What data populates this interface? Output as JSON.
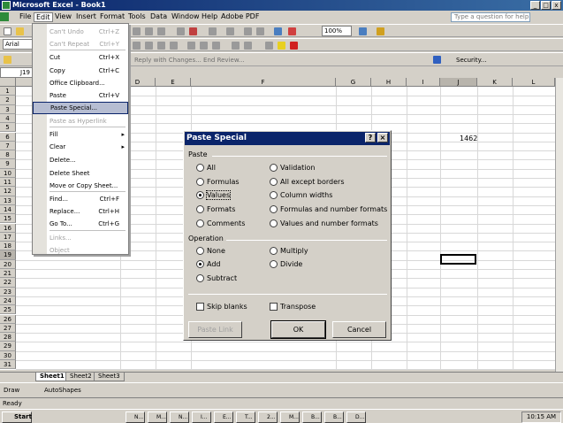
{
  "app": {
    "title": "Microsoft Excel - Book1"
  },
  "menubar": {
    "items": [
      "File",
      "Edit",
      "View",
      "Insert",
      "Format",
      "Tools",
      "Data",
      "Window",
      "Help",
      "Adobe PDF"
    ],
    "help_placeholder": "Type a question for help"
  },
  "toolbar": {
    "font": "Arial",
    "zoom": "100%",
    "review_text": "Reply with Changes...  End Review...",
    "security": "Security..."
  },
  "namebox": {
    "value": "J19"
  },
  "columns": [
    "D",
    "E",
    "F",
    "G",
    "H",
    "I",
    "J",
    "K",
    "L"
  ],
  "rows": [
    "1",
    "2",
    "3",
    "4",
    "5",
    "6",
    "7",
    "8",
    "9",
    "10",
    "11",
    "12",
    "13",
    "14",
    "15",
    "16",
    "17",
    "18",
    "19",
    "20",
    "21",
    "22",
    "23",
    "24",
    "25",
    "26",
    "27",
    "28",
    "29",
    "30",
    "31"
  ],
  "cells": {
    "J6": "1462"
  },
  "edit_menu": {
    "items": [
      {
        "label": "Can't Undo",
        "shortcut": "Ctrl+Z",
        "disabled": true
      },
      {
        "label": "Can't Repeat",
        "shortcut": "Ctrl+Y",
        "disabled": true
      },
      {
        "label": "Cut",
        "shortcut": "Ctrl+X"
      },
      {
        "label": "Copy",
        "shortcut": "Ctrl+C"
      },
      {
        "label": "Office Clipboard..."
      },
      {
        "label": "Paste",
        "shortcut": "Ctrl+V"
      },
      {
        "label": "Paste Special...",
        "highlight": true
      },
      {
        "label": "Paste as Hyperlink",
        "disabled": true
      },
      {
        "label": "Fill",
        "submenu": true
      },
      {
        "label": "Clear",
        "submenu": true
      },
      {
        "label": "Delete..."
      },
      {
        "label": "Delete Sheet"
      },
      {
        "label": "Move or Copy Sheet..."
      },
      {
        "label": "Find...",
        "shortcut": "Ctrl+F"
      },
      {
        "label": "Replace...",
        "shortcut": "Ctrl+H"
      },
      {
        "label": "Go To...",
        "shortcut": "Ctrl+G"
      },
      {
        "label": "Links...",
        "disabled": true
      },
      {
        "label": "Object",
        "disabled": true
      }
    ]
  },
  "dialog": {
    "title": "Paste Special",
    "paste_label": "Paste",
    "paste_options": [
      "All",
      "Formulas",
      "Values",
      "Formats",
      "Comments",
      "Validation",
      "All except borders",
      "Column widths",
      "Formulas and number formats",
      "Values and number formats"
    ],
    "paste_selected": "Values",
    "operation_label": "Operation",
    "operation_options": [
      "None",
      "Add",
      "Subtract",
      "Multiply",
      "Divide"
    ],
    "operation_selected": "Add",
    "skip_blanks": "Skip blanks",
    "transpose": "Transpose",
    "paste_link": "Paste Link",
    "ok": "OK",
    "cancel": "Cancel"
  },
  "sheets": [
    "Sheet1",
    "Sheet2",
    "Sheet3"
  ],
  "drawbar": {
    "draw": "Draw",
    "autoshapes": "AutoShapes"
  },
  "status": "Ready",
  "taskbar": {
    "start": "Start",
    "tasks": [
      "N...",
      "M...",
      "N...",
      "I...",
      "E...",
      "T...",
      "2...",
      "M...",
      "B...",
      "B...",
      "D..."
    ],
    "clock": "10:15 AM"
  }
}
